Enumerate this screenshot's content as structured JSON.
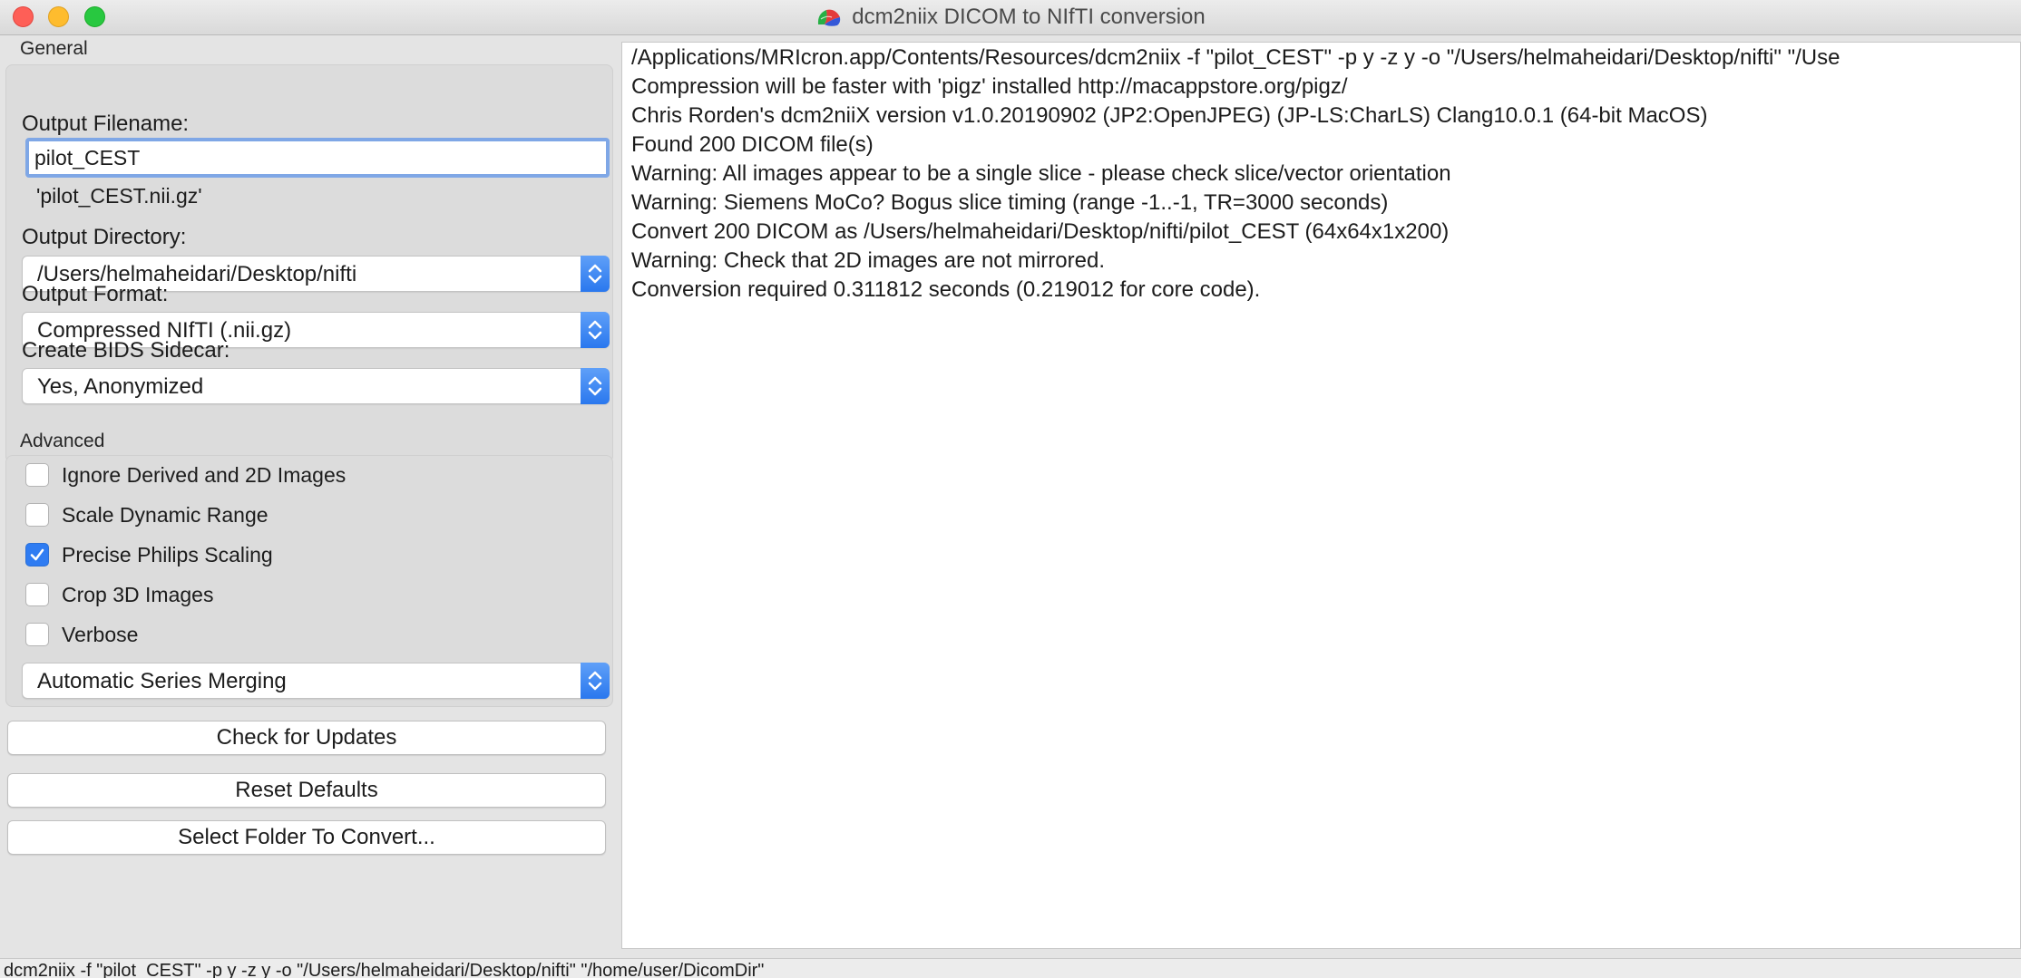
{
  "window": {
    "title": "dcm2niix DICOM to NIfTI conversion"
  },
  "general": {
    "group_label": "General",
    "output_filename_label": "Output Filename:",
    "output_filename_value": "pilot_CEST",
    "filename_preview": "'pilot_CEST.nii.gz'",
    "output_directory_label": "Output Directory:",
    "output_directory_value": "/Users/helmaheidari/Desktop/nifti",
    "output_format_label": "Output Format:",
    "output_format_value": "Compressed NIfTI (.nii.gz)",
    "bids_label": "Create BIDS Sidecar:",
    "bids_value": "Yes, Anonymized"
  },
  "advanced": {
    "group_label": "Advanced",
    "checkboxes": [
      {
        "label": "Ignore Derived and 2D Images",
        "checked": false
      },
      {
        "label": "Scale Dynamic Range",
        "checked": false
      },
      {
        "label": "Precise Philips Scaling",
        "checked": true
      },
      {
        "label": "Crop 3D Images",
        "checked": false
      },
      {
        "label": "Verbose",
        "checked": false
      }
    ],
    "merge_value": "Automatic Series Merging"
  },
  "buttons": {
    "check_updates": "Check for Updates",
    "reset_defaults": "Reset Defaults",
    "select_folder": "Select Folder To Convert..."
  },
  "log": [
    "/Applications/MRIcron.app/Contents/Resources/dcm2niix -f \"pilot_CEST\" -p y -z y -o \"/Users/helmaheidari/Desktop/nifti\" \"/Use",
    "Compression will be faster with 'pigz' installed http://macappstore.org/pigz/",
    "Chris Rorden's dcm2niiX version v1.0.20190902  (JP2:OpenJPEG) (JP-LS:CharLS) Clang10.0.1 (64-bit MacOS)",
    "Found 200 DICOM file(s)",
    "Warning: All images appear to be a single slice - please check slice/vector orientation",
    "Warning: Siemens MoCo? Bogus slice timing (range -1..-1, TR=3000 seconds)",
    "Convert 200 DICOM as /Users/helmaheidari/Desktop/nifti/pilot_CEST (64x64x1x200)",
    "Warning: Check that 2D images are not mirrored.",
    "Conversion required 0.311812 seconds (0.219012 for core code)."
  ],
  "status_bar": "dcm2niix -f \"pilot_CEST\" -p y -z y -o \"/Users/helmaheidari/Desktop/nifti\" \"/home/user/DicomDir\"",
  "colors": {
    "accent": "#2f7cf2",
    "focus_ring": "#7fa7e6",
    "close": "#fe5f57",
    "minimize": "#febc2e",
    "maximize": "#28c840"
  }
}
